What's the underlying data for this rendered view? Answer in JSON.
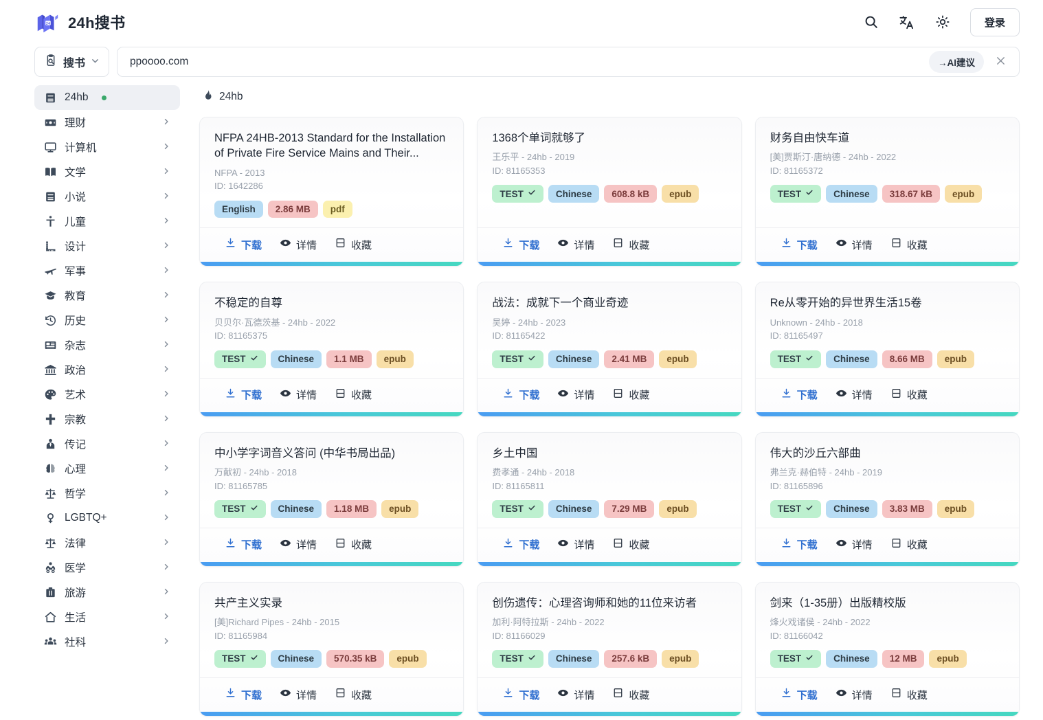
{
  "header": {
    "brand_title": "24h搜书",
    "logo_icon": "book-stack-icon",
    "search_icon": "search-icon",
    "translate_icon": "translate-icon",
    "theme_icon": "sun-icon",
    "login_label": "登录"
  },
  "search": {
    "category_label": "搜书",
    "category_icon": "clipboard-search-icon",
    "chevron_icon": "chevron-down-icon",
    "value": "ppoooo.com",
    "placeholder": "ppoooo.com",
    "ai_chip_label": "→AI建议",
    "clear_icon": "close-icon"
  },
  "sidebar": {
    "items": [
      {
        "label": "24hb",
        "icon": "book-icon",
        "active": true,
        "dot": true,
        "chevron": false
      },
      {
        "label": "理财",
        "icon": "money-icon",
        "active": false,
        "dot": false,
        "chevron": true
      },
      {
        "label": "计算机",
        "icon": "monitor-icon",
        "active": false,
        "dot": false,
        "chevron": true
      },
      {
        "label": "文学",
        "icon": "open-book-icon",
        "active": false,
        "dot": false,
        "chevron": true
      },
      {
        "label": "小说",
        "icon": "novel-icon",
        "active": false,
        "dot": false,
        "chevron": true
      },
      {
        "label": "儿童",
        "icon": "child-icon",
        "active": false,
        "dot": false,
        "chevron": true
      },
      {
        "label": "设计",
        "icon": "ruler-icon",
        "active": false,
        "dot": false,
        "chevron": true
      },
      {
        "label": "军事",
        "icon": "plane-icon",
        "active": false,
        "dot": false,
        "chevron": true
      },
      {
        "label": "教育",
        "icon": "graduation-icon",
        "active": false,
        "dot": false,
        "chevron": true
      },
      {
        "label": "历史",
        "icon": "history-clock-icon",
        "active": false,
        "dot": false,
        "chevron": true
      },
      {
        "label": "杂志",
        "icon": "magazine-icon",
        "active": false,
        "dot": false,
        "chevron": true
      },
      {
        "label": "政治",
        "icon": "bank-icon",
        "active": false,
        "dot": false,
        "chevron": true
      },
      {
        "label": "艺术",
        "icon": "palette-icon",
        "active": false,
        "dot": false,
        "chevron": true
      },
      {
        "label": "宗教",
        "icon": "cross-icon",
        "active": false,
        "dot": false,
        "chevron": true
      },
      {
        "label": "传记",
        "icon": "person-tie-icon",
        "active": false,
        "dot": false,
        "chevron": true
      },
      {
        "label": "心理",
        "icon": "brain-icon",
        "active": false,
        "dot": false,
        "chevron": true
      },
      {
        "label": "哲学",
        "icon": "scale-icon",
        "active": false,
        "dot": false,
        "chevron": true
      },
      {
        "label": "LGBTQ+",
        "icon": "venus-icon",
        "active": false,
        "dot": false,
        "chevron": true
      },
      {
        "label": "法律",
        "icon": "scale-icon",
        "active": false,
        "dot": false,
        "chevron": true
      },
      {
        "label": "医学",
        "icon": "doctor-icon",
        "active": false,
        "dot": false,
        "chevron": true
      },
      {
        "label": "旅游",
        "icon": "suitcase-icon",
        "active": false,
        "dot": false,
        "chevron": true
      },
      {
        "label": "生活",
        "icon": "home-icon",
        "active": false,
        "dot": false,
        "chevron": true
      },
      {
        "label": "社科",
        "icon": "people-icon",
        "active": false,
        "dot": false,
        "chevron": true
      }
    ]
  },
  "main": {
    "section_icon": "flame-icon",
    "section_title": "24hb",
    "actions": {
      "download_label": "下载",
      "download_icon": "download-icon",
      "details_label": "详情",
      "details_icon": "eye-icon",
      "favorite_label": "收藏",
      "favorite_icon": "bookmark-icon"
    },
    "cards": [
      {
        "title": "NFPA 24HB-2013 Standard for the Installation of Private Fire Service Mains and Their...",
        "meta": "NFPA - 2013",
        "id": "ID: 1642286",
        "tags": [
          {
            "text": "English",
            "kind": "lang"
          },
          {
            "text": "2.86 MB",
            "kind": "size"
          },
          {
            "text": "pdf",
            "kind": "fmt-pdf"
          }
        ]
      },
      {
        "title": "1368个单词就够了",
        "meta": "王乐平 - 24hb - 2019",
        "id": "ID: 81165353",
        "tags": [
          {
            "text": "TEST",
            "kind": "test"
          },
          {
            "text": "Chinese",
            "kind": "lang"
          },
          {
            "text": "608.8 kB",
            "kind": "size"
          },
          {
            "text": "epub",
            "kind": "fmt"
          }
        ]
      },
      {
        "title": "财务自由快车道",
        "meta": "[美]贾斯汀·唐纳德 - 24hb - 2022",
        "id": "ID: 81165372",
        "tags": [
          {
            "text": "TEST",
            "kind": "test"
          },
          {
            "text": "Chinese",
            "kind": "lang"
          },
          {
            "text": "318.67 kB",
            "kind": "size"
          },
          {
            "text": "epub",
            "kind": "fmt"
          }
        ]
      },
      {
        "title": "不稳定的自尊",
        "meta": "贝贝尔·瓦德茨基 - 24hb - 2022",
        "id": "ID: 81165375",
        "tags": [
          {
            "text": "TEST",
            "kind": "test"
          },
          {
            "text": "Chinese",
            "kind": "lang"
          },
          {
            "text": "1.1 MB",
            "kind": "size"
          },
          {
            "text": "epub",
            "kind": "fmt"
          }
        ]
      },
      {
        "title": "战法：成就下一个商业奇迹",
        "meta": "吴婷 - 24hb - 2023",
        "id": "ID: 81165422",
        "tags": [
          {
            "text": "TEST",
            "kind": "test"
          },
          {
            "text": "Chinese",
            "kind": "lang"
          },
          {
            "text": "2.41 MB",
            "kind": "size"
          },
          {
            "text": "epub",
            "kind": "fmt"
          }
        ]
      },
      {
        "title": "Re从零开始的异世界生活15卷",
        "meta": "Unknown - 24hb - 2018",
        "id": "ID: 81165497",
        "tags": [
          {
            "text": "TEST",
            "kind": "test"
          },
          {
            "text": "Chinese",
            "kind": "lang"
          },
          {
            "text": "8.66 MB",
            "kind": "size"
          },
          {
            "text": "epub",
            "kind": "fmt"
          }
        ]
      },
      {
        "title": "中小学字词音义答问 (中华书局出品)",
        "meta": "万献初 - 24hb - 2018",
        "id": "ID: 81165785",
        "tags": [
          {
            "text": "TEST",
            "kind": "test"
          },
          {
            "text": "Chinese",
            "kind": "lang"
          },
          {
            "text": "1.18 MB",
            "kind": "size"
          },
          {
            "text": "epub",
            "kind": "fmt"
          }
        ]
      },
      {
        "title": "乡土中国",
        "meta": "费孝通 - 24hb - 2018",
        "id": "ID: 81165811",
        "tags": [
          {
            "text": "TEST",
            "kind": "test"
          },
          {
            "text": "Chinese",
            "kind": "lang"
          },
          {
            "text": "7.29 MB",
            "kind": "size"
          },
          {
            "text": "epub",
            "kind": "fmt"
          }
        ]
      },
      {
        "title": "伟大的沙丘六部曲",
        "meta": "弗兰克·赫伯特 - 24hb - 2019",
        "id": "ID: 81165896",
        "tags": [
          {
            "text": "TEST",
            "kind": "test"
          },
          {
            "text": "Chinese",
            "kind": "lang"
          },
          {
            "text": "3.83 MB",
            "kind": "size"
          },
          {
            "text": "epub",
            "kind": "fmt"
          }
        ]
      },
      {
        "title": "共产主义实录",
        "meta": "[美]Richard Pipes - 24hb - 2015",
        "id": "ID: 81165984",
        "tags": [
          {
            "text": "TEST",
            "kind": "test"
          },
          {
            "text": "Chinese",
            "kind": "lang"
          },
          {
            "text": "570.35 kB",
            "kind": "size"
          },
          {
            "text": "epub",
            "kind": "fmt"
          }
        ]
      },
      {
        "title": "创伤遗传：心理咨询师和她的11位来访者",
        "meta": "加利·阿特拉斯 - 24hb - 2022",
        "id": "ID: 81166029",
        "tags": [
          {
            "text": "TEST",
            "kind": "test"
          },
          {
            "text": "Chinese",
            "kind": "lang"
          },
          {
            "text": "257.6 kB",
            "kind": "size"
          },
          {
            "text": "epub",
            "kind": "fmt"
          }
        ]
      },
      {
        "title": "剑来（1-35册）出版精校版",
        "meta": "烽火戏诸侯 - 24hb - 2022",
        "id": "ID: 81166042",
        "tags": [
          {
            "text": "TEST",
            "kind": "test"
          },
          {
            "text": "Chinese",
            "kind": "lang"
          },
          {
            "text": "12 MB",
            "kind": "size"
          },
          {
            "text": "epub",
            "kind": "fmt"
          }
        ]
      }
    ]
  },
  "colors": {
    "accent_blue": "#2f6fd0",
    "bar_start": "#4a9cf2",
    "bar_end": "#46d8c0",
    "dot_green": "#3aa86b",
    "tag_test_bg": "#bdf0cf",
    "tag_lang_bg": "#b8dcf4",
    "tag_size_bg": "#f6c4c4",
    "tag_fmt_bg": "#f8dfa8"
  }
}
